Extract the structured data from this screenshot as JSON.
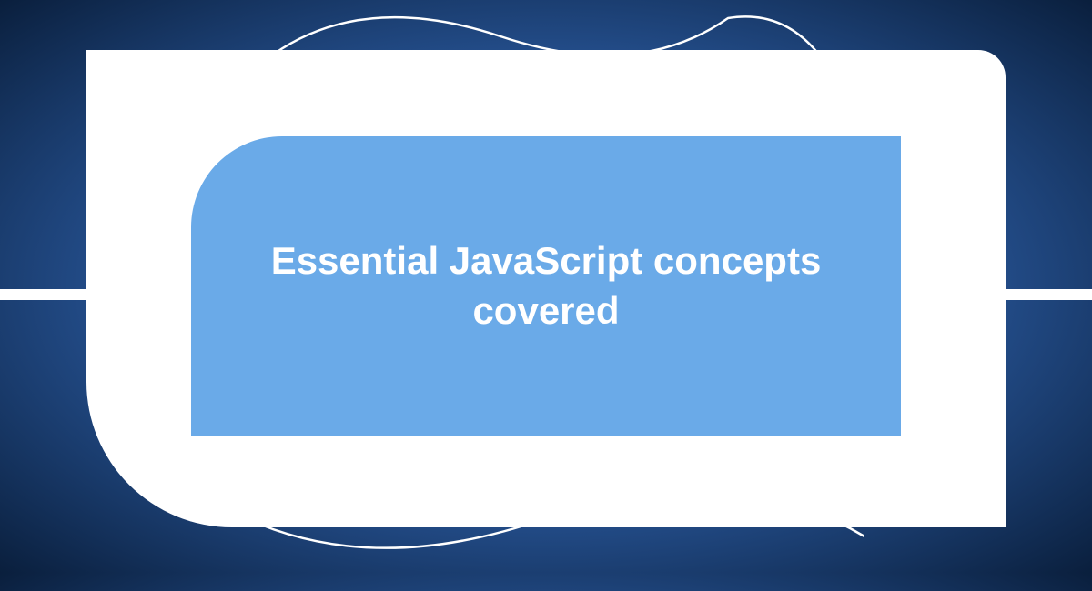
{
  "banner": {
    "title": "Essential JavaScript concepts covered"
  },
  "colors": {
    "background_dark": "#0a1f3d",
    "background_mid": "#2d5fa8",
    "background_light": "#5a9de8",
    "inner_panel": "#6aaae8",
    "frame": "#ffffff",
    "text": "#ffffff"
  }
}
